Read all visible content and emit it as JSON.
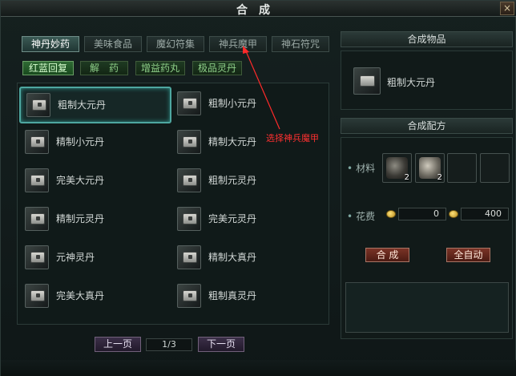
{
  "window": {
    "title": "合成",
    "close_label": "×"
  },
  "tabs": [
    {
      "label": "神丹妙药",
      "active": true
    },
    {
      "label": "美味食品",
      "active": false
    },
    {
      "label": "魔幻符集",
      "active": false
    },
    {
      "label": "神兵魔甲",
      "active": false
    },
    {
      "label": "神石符咒",
      "active": false
    }
  ],
  "subtabs": [
    {
      "label": "红蓝回复",
      "active": true
    },
    {
      "label": "解　药",
      "active": false
    },
    {
      "label": "增益药丸",
      "active": false
    },
    {
      "label": "极品灵丹",
      "active": false
    }
  ],
  "items": [
    {
      "label": "粗制大元丹",
      "icon": "pill-box-icon",
      "selected": true
    },
    {
      "label": "粗制小元丹",
      "icon": "pill-box-icon",
      "selected": false
    },
    {
      "label": "精制小元丹",
      "icon": "pill-box-icon",
      "selected": false
    },
    {
      "label": "精制大元丹",
      "icon": "pill-box-icon",
      "selected": false
    },
    {
      "label": "完美大元丹",
      "icon": "pill-box-icon",
      "selected": false
    },
    {
      "label": "粗制元灵丹",
      "icon": "pill-box-icon",
      "selected": false
    },
    {
      "label": "精制元灵丹",
      "icon": "pill-box-icon",
      "selected": false
    },
    {
      "label": "完美元灵丹",
      "icon": "pill-box-icon",
      "selected": false
    },
    {
      "label": "元神灵丹",
      "icon": "pill-box-icon",
      "selected": false
    },
    {
      "label": "精制大真丹",
      "icon": "pill-box-icon",
      "selected": false
    },
    {
      "label": "完美大真丹",
      "icon": "pill-box-icon",
      "selected": false
    },
    {
      "label": "粗制真灵丹",
      "icon": "pill-box-icon",
      "selected": false
    }
  ],
  "pager": {
    "prev_label": "上一页",
    "page": "1/3",
    "next_label": "下一页"
  },
  "result": {
    "header": "合成物品",
    "item_label": "粗制大元丹"
  },
  "recipe": {
    "header": "合成配方",
    "materials_label": "材料",
    "materials": [
      {
        "icon": "ore-icon",
        "qty": "2"
      },
      {
        "icon": "ore-icon",
        "qty": "2"
      },
      {
        "icon": "empty-slot",
        "qty": ""
      },
      {
        "icon": "empty-slot",
        "qty": ""
      }
    ],
    "cost_label": "花费",
    "cost_gold": "0",
    "cost_silver": "400"
  },
  "actions": {
    "craft_label": "合 成",
    "auto_label": "全自动"
  },
  "annotation": {
    "text": "选择神兵魔甲",
    "color": "#ff3030"
  }
}
